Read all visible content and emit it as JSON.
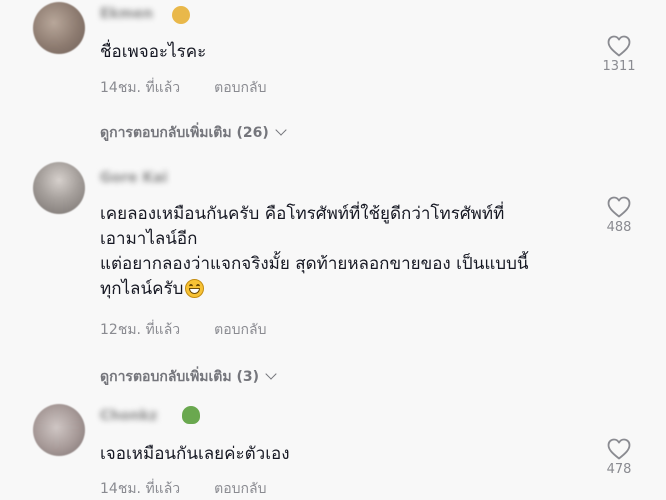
{
  "comments": [
    {
      "username": "Ekmen",
      "lines": [
        "ชื่อเพจอะไรคะ"
      ],
      "time": "14ชม. ที่แล้ว",
      "reply_label": "ตอบกลับ",
      "likes": "1311",
      "more_replies": "ดูการตอบกลับเพิ่มเติม (26)"
    },
    {
      "username": "Gore Kai",
      "lines": [
        "เคยลองเหมือนกันครับ คือโทรศัพท์ที่ใช้ยูดีกว่าโทรศัพท์ที่",
        "เอามาไลน์อีก",
        "แต่อยากลองว่าแจกจริงมั้ย สุดท้ายหลอกขายของ เป็นแบบนี้",
        "ทุกไลน์ครับ"
      ],
      "time": "12ชม. ที่แล้ว",
      "reply_label": "ตอบกลับ",
      "likes": "488",
      "more_replies": "ดูการตอบกลับเพิ่มเติม (3)"
    },
    {
      "username": "Chonkz",
      "lines": [
        "เจอเหมือนกันเลยค่ะตัวเอง"
      ],
      "time": "14ชม. ที่แล้ว",
      "reply_label": "ตอบกลับ",
      "likes": "478"
    }
  ],
  "icons": {
    "like": "heart-outline-icon",
    "expand": "chevron-down-icon",
    "emoji": "grinning-face-emoji"
  },
  "colors": {
    "background": "#f8f8f8",
    "text": "#161823",
    "secondary": "#8a8b91"
  }
}
